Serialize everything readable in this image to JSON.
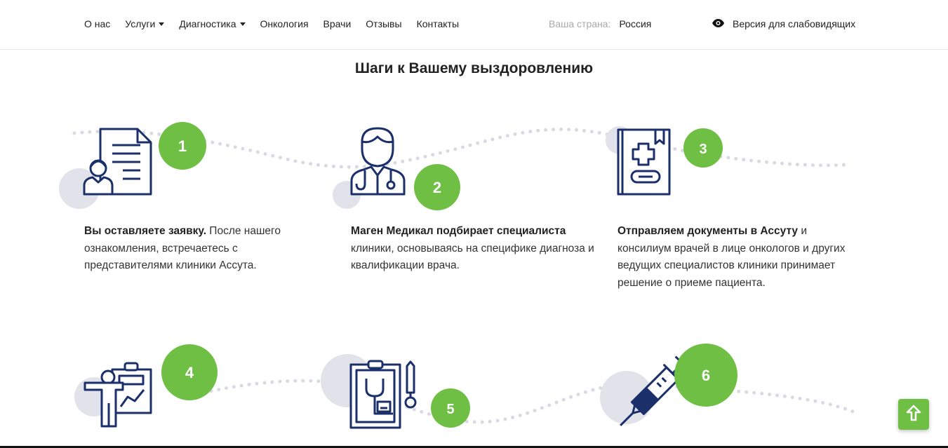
{
  "nav": {
    "items": [
      {
        "label": "О нас",
        "dropdown": false
      },
      {
        "label": "Услуги",
        "dropdown": true
      },
      {
        "label": "Диагностика",
        "dropdown": true
      },
      {
        "label": "Онкология",
        "dropdown": false
      },
      {
        "label": "Врачи",
        "dropdown": false
      },
      {
        "label": "Отзывы",
        "dropdown": false
      },
      {
        "label": "Контакты",
        "dropdown": false
      }
    ],
    "country_label": "Ваша страна:",
    "country_value": "Россия",
    "vision_label": "Версия для слабовидящих"
  },
  "section": {
    "title": "Шаги к Вашему выздоровлению"
  },
  "steps": [
    {
      "number": "1",
      "icon": "document-person-icon",
      "bold": "Вы оставляете заявку.",
      "text": " После нашего ознакомления, встречаетесь с представителями клиники Ассута."
    },
    {
      "number": "2",
      "icon": "doctor-icon",
      "bold": "Маген Медикал подбирает специалиста",
      "text": " клиники, основываясь на специфике диагноза и квалификации врача."
    },
    {
      "number": "3",
      "icon": "medical-book-icon",
      "bold": "Отправляем документы в Ассуту",
      "text": " и консилиум врачей в лице онкологов и других ведущих специалистов клиники принимает решение о приеме пациента."
    },
    {
      "number": "4",
      "icon": "presentation-icon",
      "bold": "",
      "text": ""
    },
    {
      "number": "5",
      "icon": "clipboard-stethoscope-icon",
      "bold": "",
      "text": ""
    },
    {
      "number": "6",
      "icon": "syringe-icon",
      "bold": "",
      "text": ""
    }
  ],
  "colors": {
    "accent": "#6fbf44",
    "icon": "#1b2f6b",
    "circle_gray": "#e2e2ea",
    "dots": "#d9d9e3"
  }
}
